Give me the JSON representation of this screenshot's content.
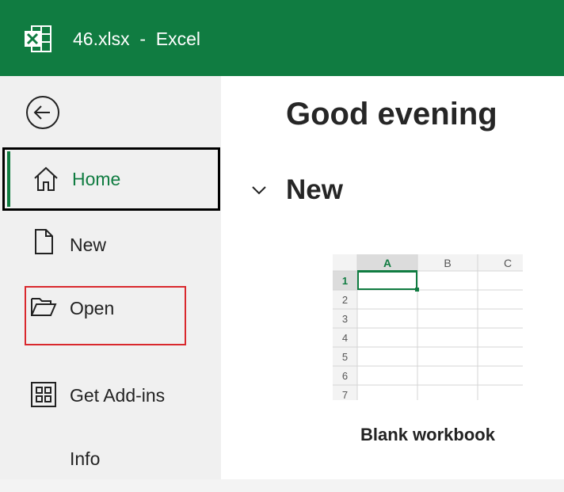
{
  "titlebar": {
    "title": "46.xlsx  -  Excel",
    "color": "#107c41"
  },
  "sidebar": {
    "back_icon": "arrow-left-circle-icon",
    "items": [
      {
        "label": "Home",
        "icon": "home-icon",
        "active": true
      },
      {
        "label": "New",
        "icon": "document-icon"
      },
      {
        "label": "Open",
        "icon": "folder-open-icon",
        "highlighted": true
      },
      {
        "label": "Get Add-ins",
        "icon": "grid-icon"
      },
      {
        "label": "Info"
      }
    ]
  },
  "main": {
    "greeting": "Good evening",
    "section_title": "New",
    "templates": [
      {
        "label": "Blank workbook",
        "columns": [
          "A",
          "B",
          "C"
        ],
        "rows": [
          "1",
          "2",
          "3",
          "4",
          "5",
          "6",
          "7"
        ]
      }
    ]
  },
  "colors": {
    "accent": "#107c41",
    "highlight": "#d9282d"
  }
}
